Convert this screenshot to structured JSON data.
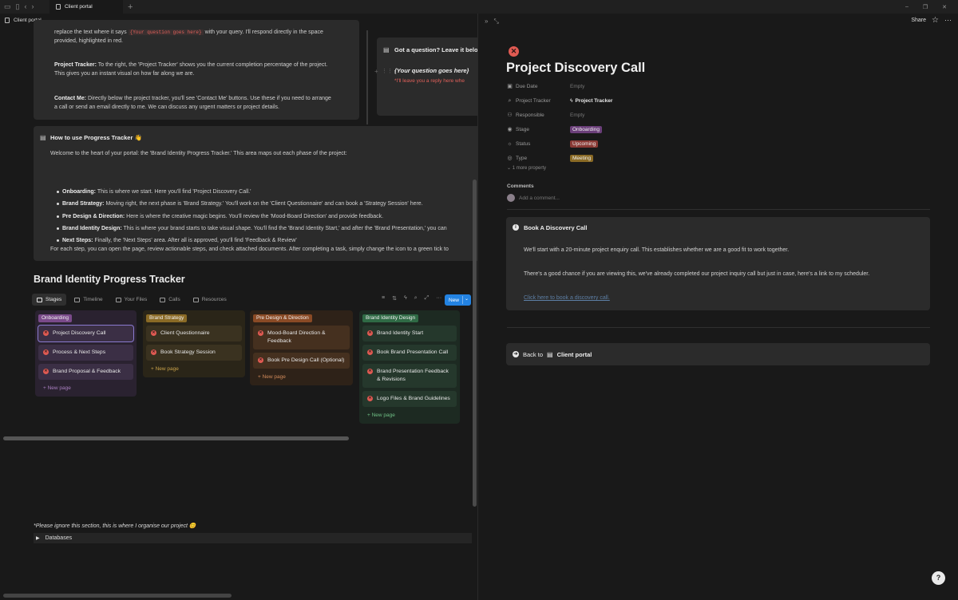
{
  "tab": {
    "title": "Client portal"
  },
  "breadcrumb": "Client portal",
  "intro": {
    "q_text_a": "replace the text where it says",
    "q_code": "{Your question goes here}",
    "q_text_b": "with your query. I'll respond directly in the space",
    "q_text_c": "provided, highlighted in red.",
    "tracker_label": "Project Tracker:",
    "tracker_text_a": "To the right, the 'Project Tracker' shows you the current completion percentage of the project.",
    "tracker_text_b": "This gives you an instant visual on how far along we are.",
    "contact_label": "Contact Me:",
    "contact_text_a": "Directly below the project tracker, you'll see 'Contact Me' buttons. Use these if you need to arrange",
    "contact_text_b": "a call or send an email directly to me. We can discuss any urgent matters or project details."
  },
  "question_box": {
    "title": "Got a question? Leave it belo",
    "placeholder": "{Your question goes here}",
    "reply": "*I'll leave you a reply here whe"
  },
  "howto": {
    "title": "How to use Progress Tracker 👋",
    "intro": "Welcome to the heart of your portal: the 'Brand Identity Progress Tracker.' This area maps out each phase of the project:",
    "bullets": [
      {
        "label": "Onboarding:",
        "text": "This is where we start. Here you'll find  'Project Discovery Call.'"
      },
      {
        "label": "Brand Strategy:",
        "text": "Moving right, the next phase is 'Brand Strategy.' You'll work on the 'Client Questionnaire' and can book a 'Strategy Session' here."
      },
      {
        "label": "Pre Design & Direction:",
        "text": "Here is where the creative magic begins. You'll review the 'Mood-Board Direction' and provide feedback."
      },
      {
        "label": "Brand Identity Design:",
        "text": "This is where your brand starts to take visual shape. You'll find the 'Brand Identity Start,' and after the 'Brand Presentation,' you can"
      },
      {
        "label": "Next Steps:",
        "text": "Finally, the 'Next Steps' area. After all is approved, you'll find 'Feedback & Review'"
      }
    ],
    "footer": "For each step, you can open the page, review actionable steps, and check attached documents. After completing a task, simply change the icon to a green tick to"
  },
  "tracker": {
    "heading": "Brand Identity Progress Tracker",
    "views": [
      "Stages",
      "Timeline",
      "Your Files",
      "Calls",
      "Resources"
    ],
    "new_label": "New",
    "new_page": "New page",
    "columns": [
      {
        "name": "Onboarding",
        "color": "#7a4a8a",
        "bg": "#2a2230",
        "card": "#3b2f45",
        "cards": [
          "Project Discovery Call",
          "Process & Next Steps",
          "Brand Proposal & Feedback"
        ],
        "newcolor": "#a97fc0"
      },
      {
        "name": "Brand Strategy",
        "color": "#8a6a25",
        "bg": "#2a2518",
        "card": "#3a3220",
        "cards": [
          "Client Questionnaire",
          "Book Strategy Session"
        ],
        "newcolor": "#c9a24a"
      },
      {
        "name": "Pre Design & Direction",
        "color": "#8a4a25",
        "bg": "#2e2218",
        "card": "#45301f",
        "cards": [
          "Mood-Board Direction & Feedback",
          "Book Pre Design Call (Optional)"
        ],
        "newcolor": "#d08a5a"
      },
      {
        "name": "Brand Identity Design",
        "color": "#2f6a45",
        "bg": "#1d2a22",
        "card": "#25382c",
        "cards": [
          "Brand Identity Start",
          "Book Brand Presentation Call",
          "Brand Presentation Feedback & Revisions",
          "Logo Files & Brand Guidelines"
        ],
        "newcolor": "#6fbf85"
      }
    ]
  },
  "ignore_note": "*Please ignore this section, this is where I organise our project 😊",
  "databases": "Databases",
  "right": {
    "share": "Share",
    "title": "Project Discovery Call",
    "props": [
      {
        "icon": "calendar-icon",
        "key": "Due Date",
        "value": "Empty",
        "kind": "empty"
      },
      {
        "icon": "search-icon",
        "key": "Project Tracker",
        "value": "Project Tracker",
        "kind": "link"
      },
      {
        "icon": "people-icon",
        "key": "Responsible",
        "value": "Empty",
        "kind": "empty"
      },
      {
        "icon": "stage-icon",
        "key": "Stage",
        "value": "Onboarding",
        "kind": "tag",
        "color": "#6b3f7a"
      },
      {
        "icon": "status-icon",
        "key": "Status",
        "value": "Upcoming",
        "kind": "tag",
        "color": "#8a3a35"
      },
      {
        "icon": "type-icon",
        "key": "Type",
        "value": "Meeting",
        "kind": "tag",
        "color": "#8a6a25"
      }
    ],
    "more_property": "1 more property",
    "comments": "Comments",
    "add_comment": "Add a comment...",
    "book": {
      "title": "Book A Discovery Call",
      "p1": "We'll start with a 20-minute project enquiry call. This establishes whether we are a good fit to work together.",
      "p2": "There's a good chance if you are viewing this, we've already completed our project inquiry call but just in case, here's a link to my scheduler.",
      "link": "Click here to book a discovery call."
    },
    "back": {
      "prefix": "Back to",
      "target": "Client portal"
    }
  }
}
